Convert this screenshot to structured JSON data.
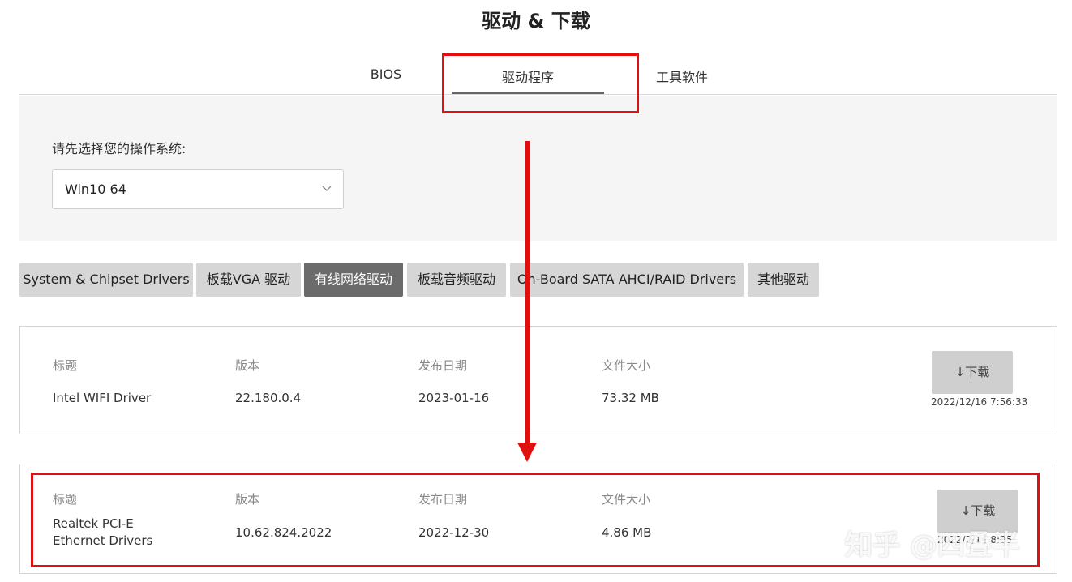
{
  "page": {
    "title": "驱动 & 下载"
  },
  "tabs": [
    {
      "label": "BIOS",
      "active": false
    },
    {
      "label": "驱动程序",
      "active": true
    },
    {
      "label": "工具软件",
      "active": false
    }
  ],
  "os_selector": {
    "label": "请先选择您的操作系统:",
    "value": "Win10 64"
  },
  "categories": [
    {
      "label": "System & Chipset Drivers",
      "active": false
    },
    {
      "label": "板载VGA 驱动",
      "active": false
    },
    {
      "label": "有线网络驱动",
      "active": true
    },
    {
      "label": "板载音频驱动",
      "active": false
    },
    {
      "label": "On-Board SATA AHCI/RAID Drivers",
      "active": false
    },
    {
      "label": "其他驱动",
      "active": false
    }
  ],
  "columns": {
    "title": "标题",
    "version": "版本",
    "date": "发布日期",
    "size": "文件大小"
  },
  "drivers": [
    {
      "title": "Intel WIFI Driver",
      "version": "22.180.0.4",
      "date": "2023-01-16",
      "size": "73.32 MB",
      "download_label": "↓下载",
      "timestamp": "2022/12/16 7:56:33"
    },
    {
      "title_line1": "Realtek PCI-E",
      "title_line2": "Ethernet Drivers",
      "version": "10.62.824.2022",
      "date": "2022-12-30",
      "size": "4.86 MB",
      "download_label": "↓下载",
      "timestamp": "2022/2/14 8:05"
    }
  ],
  "watermark": {
    "text": "知乎 @四叠半"
  },
  "colors": {
    "highlight": "#e01010",
    "active_category": "#6b6b6b",
    "inactive_category": "#d6d6d6",
    "panel": "#f5f5f5"
  },
  "icons": {
    "select_arrow": "chevron-down-icon",
    "download": "download-arrow-icon"
  }
}
